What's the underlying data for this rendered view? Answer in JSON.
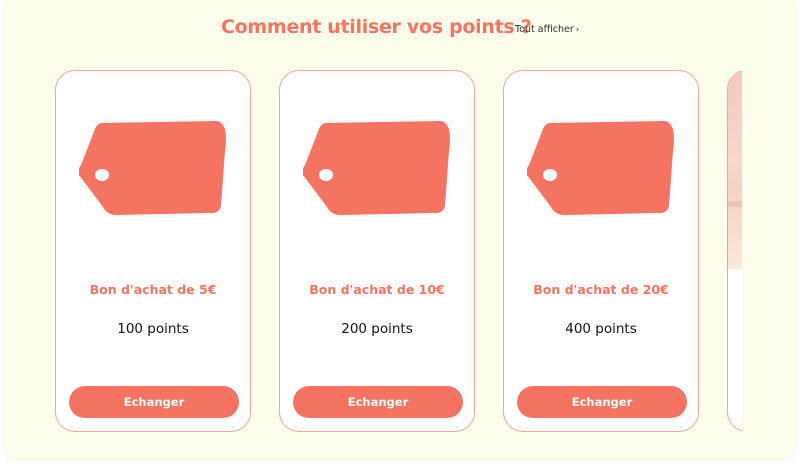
{
  "header": {
    "title": "Comment utiliser vos points ?",
    "see_all_label": "Tout afficher",
    "see_all_icon": "chevron-right-icon"
  },
  "colors": {
    "accent": "#f47361",
    "background": "#fdfdeb",
    "card_border": "#f0a59b"
  },
  "cards": [
    {
      "title": "Bon d'achat de 5€",
      "points": "100 points",
      "button_label": "Echanger",
      "icon": "price-tag-icon"
    },
    {
      "title": "Bon d'achat de 10€",
      "points": "200 points",
      "button_label": "Echanger",
      "icon": "price-tag-icon"
    },
    {
      "title": "Bon d'achat de 20€",
      "points": "400 points",
      "button_label": "Echanger",
      "icon": "price-tag-icon"
    }
  ]
}
